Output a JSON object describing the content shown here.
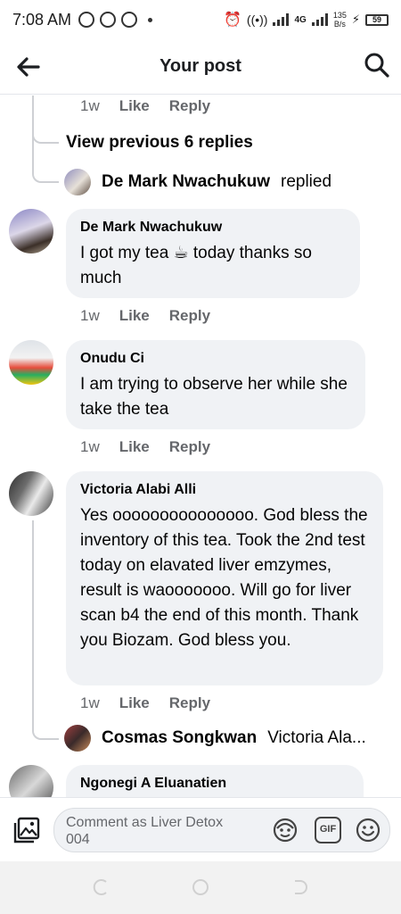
{
  "status_bar": {
    "time": "7:08 AM",
    "network": "4G",
    "speed_value": "135",
    "speed_unit": "B/s",
    "battery": "59"
  },
  "header": {
    "title": "Your post"
  },
  "thread_top": {
    "time": "1w",
    "like": "Like",
    "reply": "Reply",
    "view_previous": "View previous 6 replies",
    "reply_summary_name": "De Mark Nwachukuw",
    "reply_summary_text": "replied"
  },
  "comments": [
    {
      "name": "De Mark Nwachukuw",
      "text": "I got my tea ☕ today thanks so much",
      "time": "1w",
      "like": "Like",
      "reply": "Reply"
    },
    {
      "name": "Onudu Ci",
      "text": "I am trying to observe her  while she take the tea",
      "time": "1w",
      "like": "Like",
      "reply": "Reply"
    },
    {
      "name": "Victoria Alabi Alli",
      "text": "Yes ooooooooooooooo. God bless the inventory of this tea. Took the 2nd test today on elavated liver emzymes, result is waooooooo. Will go for liver scan b4 the end of this month. Thank you Biozam. God bless you.",
      "time": "1w",
      "like": "Like",
      "reply": "Reply",
      "reply_summary_name": "Cosmas Songkwan",
      "reply_summary_text": "Victoria Ala..."
    },
    {
      "name": "Ngonegi A Eluanatien"
    }
  ],
  "comment_bar": {
    "placeholder": "Comment as Liver Detox 004",
    "gif_label": "GIF"
  },
  "icons": {
    "back": "arrow-left-icon",
    "search": "search-icon",
    "photo": "photo-icon",
    "avatar_sticker": "avatar-sticker-icon",
    "gif": "gif-icon",
    "emoji": "emoji-icon"
  },
  "colors": {
    "bubble": "#f0f2f5",
    "secondary_text": "#65676b",
    "thread_line": "#ced0d4"
  }
}
